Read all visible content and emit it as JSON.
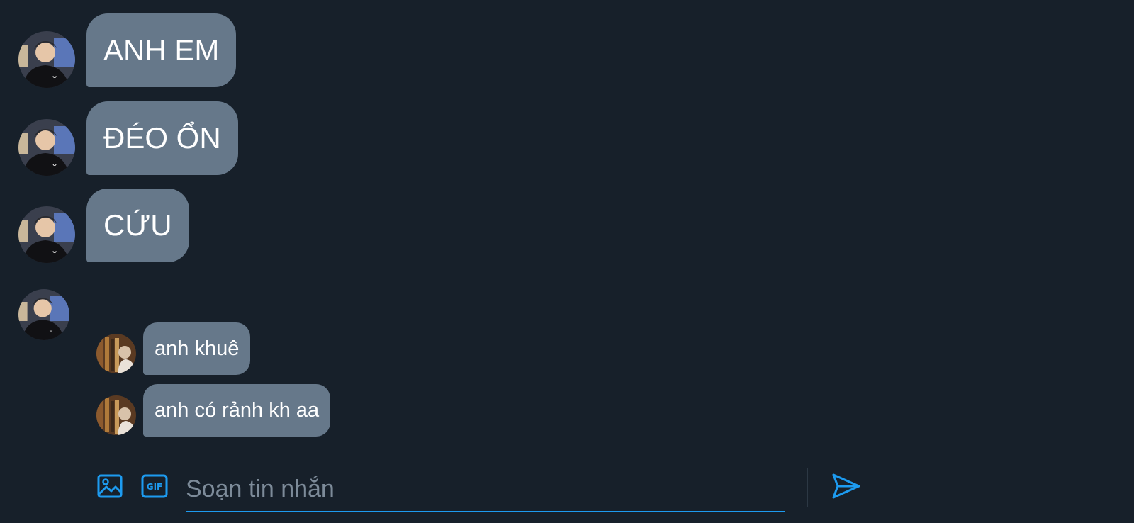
{
  "colors": {
    "background": "#17202a",
    "bubble": "#66788a",
    "accent": "#1d9bf0",
    "placeholder": "#7d8b99"
  },
  "messages": [
    {
      "sender": "user-1",
      "text": "ANH EM",
      "size": "large"
    },
    {
      "sender": "user-1",
      "text": "ĐÉO ỔN",
      "size": "large"
    },
    {
      "sender": "user-1",
      "text": "CỨU",
      "size": "large"
    },
    {
      "sender": "user-2",
      "text": "anh khuê",
      "size": "small",
      "quoted": true
    },
    {
      "sender": "user-2",
      "text": "anh có rảnh kh aa",
      "size": "small",
      "quoted": true
    }
  ],
  "composer": {
    "placeholder": "Soạn tin nhắn",
    "value": "",
    "icons": [
      "image-icon",
      "gif-icon",
      "send-icon"
    ]
  }
}
